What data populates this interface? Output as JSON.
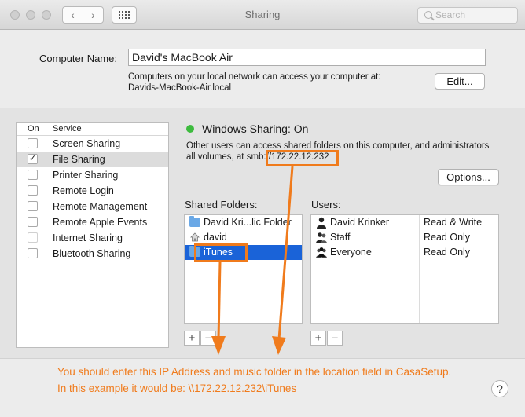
{
  "window": {
    "title": "Sharing",
    "search_placeholder": "Search"
  },
  "computer": {
    "name_label": "Computer Name:",
    "name_value": "David's MacBook Air",
    "access_line1": "Computers on your local network can access your computer at:",
    "access_line2": "Davids-MacBook-Air.local",
    "edit_label": "Edit..."
  },
  "services": {
    "col_on": "On",
    "col_service": "Service",
    "items": [
      {
        "label": "Screen Sharing",
        "checked": false
      },
      {
        "label": "File Sharing",
        "checked": true,
        "selected": true
      },
      {
        "label": "Printer Sharing",
        "checked": false
      },
      {
        "label": "Remote Login",
        "checked": false
      },
      {
        "label": "Remote Management",
        "checked": false
      },
      {
        "label": "Remote Apple Events",
        "checked": false
      },
      {
        "label": "Internet Sharing",
        "checked": false,
        "disabled": true
      },
      {
        "label": "Bluetooth Sharing",
        "checked": false
      }
    ]
  },
  "status": {
    "title": "Windows Sharing: On",
    "color": "#3dbb3e",
    "desc_line1": "Other users can access shared folders on this computer, and administrators",
    "desc_line2_prefix": "all volumes, at smb:",
    "address": "//172.22.12.232",
    "options_label": "Options..."
  },
  "shared_folders": {
    "label": "Shared Folders:",
    "items": [
      {
        "label": "David Kri...lic Folder",
        "icon": "folder-icon"
      },
      {
        "label": "david",
        "icon": "home-icon"
      },
      {
        "label": "iTunes",
        "icon": "folder-icon",
        "selected": true
      }
    ]
  },
  "users": {
    "label": "Users:",
    "items": [
      {
        "name": "David Krinker",
        "permission": "Read & Write",
        "icon": "user-icon"
      },
      {
        "name": "Staff",
        "permission": "Read Only",
        "icon": "group-icon"
      },
      {
        "name": "Everyone",
        "permission": "Read Only",
        "icon": "everyone-icon"
      }
    ]
  },
  "controls": {
    "add": "+",
    "remove": "−",
    "help": "?"
  },
  "annotation": {
    "line1": "You should enter this IP Address and music folder in the location field in CasaSetup.",
    "line2": "In this example it would be:  \\\\172.22.12.232\\iTunes",
    "color": "#f07b1c"
  }
}
